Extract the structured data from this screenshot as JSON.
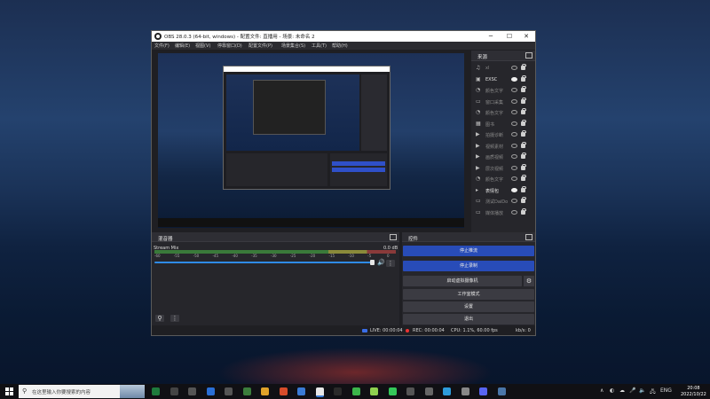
{
  "window": {
    "title": "OBS 28.0.3 (64-bit, windows) - 配置文件: 直播用 - 场景: 未命名 2",
    "minimize": "─",
    "maximize": "☐",
    "close": "✕"
  },
  "menu": [
    "文件(F)",
    "编辑(E)",
    "视图(V)",
    "停靠窗口(D)",
    "配置文件(P)",
    "场景集合(S)",
    "工具(T)",
    "帮助(H)"
  ],
  "sources": {
    "title": "来源",
    "items": [
      {
        "name": "xl",
        "visible": false
      },
      {
        "name": "EXSC",
        "visible": true
      },
      {
        "name": "颜色文字",
        "visible": false
      },
      {
        "name": "窗口采集",
        "visible": false
      },
      {
        "name": "颜色文字",
        "visible": false
      },
      {
        "name": "图书",
        "visible": false
      },
      {
        "name": "拍摄诊断",
        "visible": false
      },
      {
        "name": "视频素材",
        "visible": false
      },
      {
        "name": "画质视频",
        "visible": false
      },
      {
        "name": "层次视频",
        "visible": false
      },
      {
        "name": "颜色文字",
        "visible": false
      },
      {
        "name": "表情包",
        "visible": true
      },
      {
        "name": "测试DaiDo",
        "visible": false
      },
      {
        "name": "媒体播放",
        "visible": false
      }
    ],
    "tools": {
      "add": "+",
      "remove": "🗑",
      "settings": "⚙",
      "up": "∧",
      "more": "⋮"
    }
  },
  "mixer": {
    "title": "混音器",
    "channel": "Stream Mix",
    "db": "0.0 dB",
    "ticks": [
      "-60",
      "-55",
      "-50",
      "-45",
      "-40",
      "-35",
      "-30",
      "-25",
      "-20",
      "-15",
      "-10",
      "-5",
      "0"
    ],
    "volume": 0.9
  },
  "controls": {
    "title": "控件",
    "stop_stream": "停止推流",
    "stop_record": "停止录制",
    "virtual_cam": "启动虚拟摄像机",
    "studio_mode": "工作室模式",
    "settings": "设置",
    "exit": "退出"
  },
  "status": {
    "live": "LIVE: 00:00:04",
    "rec": "REC: 00:00:04",
    "cpu": "CPU: 1.1%, 60.00 fps",
    "kbps": "kb/s: 0"
  },
  "taskbar": {
    "search_placeholder": "在这里输入你要搜索的内容",
    "tray_lang": "ENG",
    "time": "20:08",
    "date": "2022/10/22",
    "tray_chevron": "∧"
  },
  "colors": {
    "accent_blue": "#284cb8",
    "rec_red": "#e33333",
    "panel": "#26262b"
  }
}
